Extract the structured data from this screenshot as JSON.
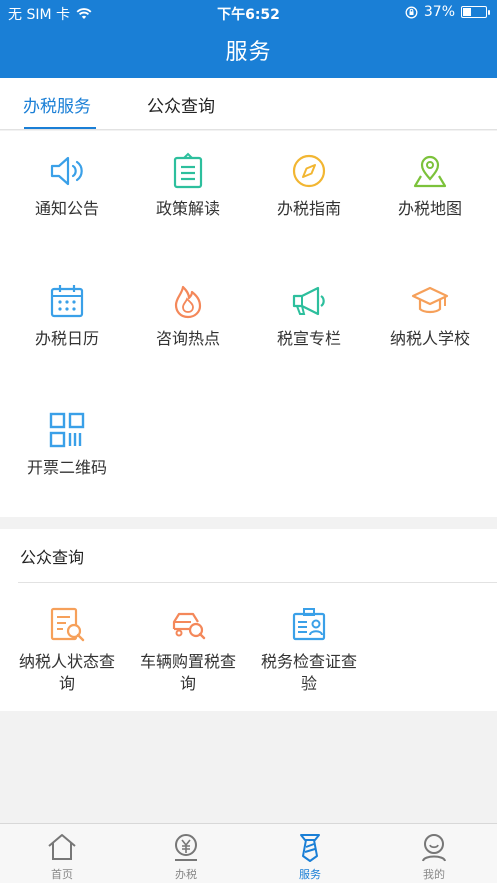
{
  "status_bar": {
    "carrier": "无 SIM 卡",
    "time": "下午6:52",
    "battery": "37%",
    "battery_level": 0.37
  },
  "nav": {
    "title": "服务"
  },
  "tabs": [
    {
      "label": "办税服务",
      "active": true
    },
    {
      "label": "公众查询",
      "active": false
    }
  ],
  "services": [
    {
      "label": "通知公告",
      "icon": "speaker-icon"
    },
    {
      "label": "政策解读",
      "icon": "document-icon"
    },
    {
      "label": "办税指南",
      "icon": "compass-icon"
    },
    {
      "label": "办税地图",
      "icon": "map-pin-icon"
    },
    {
      "label": "办税日历",
      "icon": "calendar-icon"
    },
    {
      "label": "咨询热点",
      "icon": "flame-icon"
    },
    {
      "label": "税宣专栏",
      "icon": "megaphone-icon"
    },
    {
      "label": "纳税人学校",
      "icon": "graduation-cap-icon"
    },
    {
      "label": "开票二维码",
      "icon": "qr-code-icon"
    }
  ],
  "public_query": {
    "title": "公众查询",
    "items": [
      {
        "label_line1": "纳税人状态查",
        "label_line2": "询",
        "icon": "document-search-icon"
      },
      {
        "label_line1": "车辆购置税查",
        "label_line2": "询",
        "icon": "car-search-icon"
      },
      {
        "label_line1": "税务检查证查",
        "label_line2": "验",
        "icon": "id-card-icon"
      }
    ]
  },
  "tabbar": [
    {
      "label": "首页",
      "icon": "home-icon",
      "active": false
    },
    {
      "label": "办税",
      "icon": "yen-coin-icon",
      "active": false
    },
    {
      "label": "服务",
      "icon": "service-tie-icon",
      "active": true
    },
    {
      "label": "我的",
      "icon": "user-icon",
      "active": false
    }
  ],
  "colors": {
    "primary": "#1a7fd6",
    "blue_icon": "#3aa0e8",
    "teal_icon": "#2dbf9d",
    "yellow_icon": "#f2b632",
    "green_icon": "#7cc23b",
    "orange_icon": "#f4885a",
    "orange_icon2": "#f6a05a"
  }
}
